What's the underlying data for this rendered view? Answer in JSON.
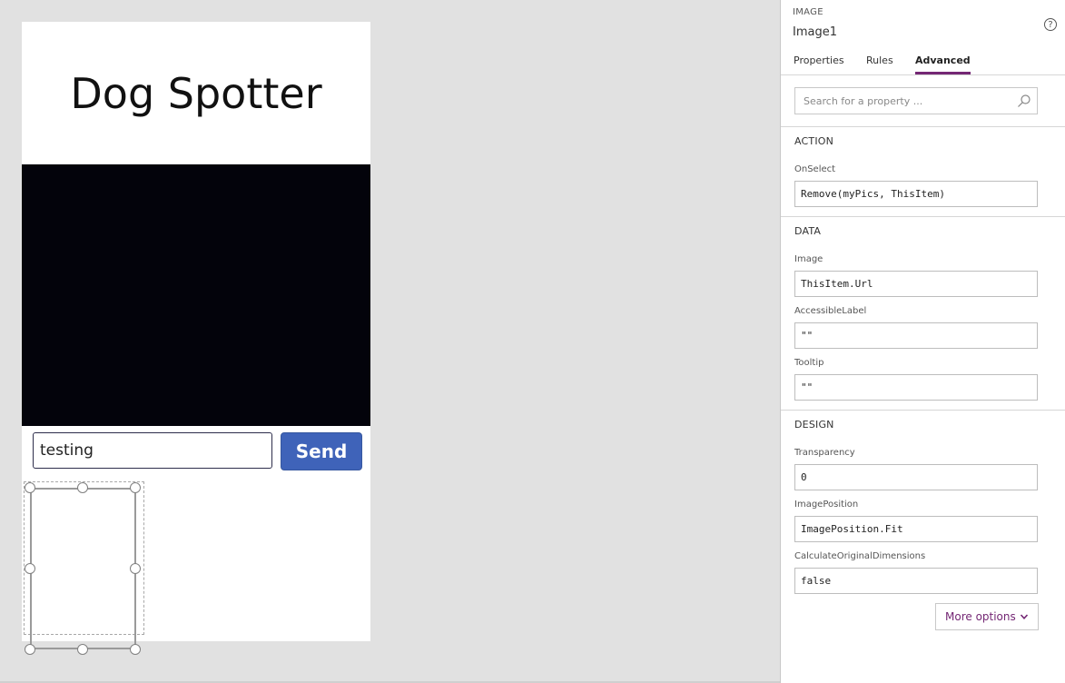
{
  "app": {
    "title": "Dog Spotter",
    "input_value": "testing",
    "send_label": "Send"
  },
  "panel": {
    "control_type": "IMAGE",
    "control_name": "Image1",
    "help_symbol": "?",
    "tabs": [
      "Properties",
      "Rules",
      "Advanced"
    ],
    "active_tab": "Advanced",
    "search_placeholder": "Search for a property ...",
    "sections": {
      "action": {
        "title": "ACTION",
        "onselect_label": "OnSelect",
        "onselect_value": "Remove(myPics, ThisItem)"
      },
      "data": {
        "title": "DATA",
        "image_label": "Image",
        "image_value": "ThisItem.Url",
        "accessible_label": "AccessibleLabel",
        "accessible_value": "\"\"",
        "tooltip_label": "Tooltip",
        "tooltip_value": "\"\""
      },
      "design": {
        "title": "DESIGN",
        "transparency_label": "Transparency",
        "transparency_value": "0",
        "imageposition_label": "ImagePosition",
        "imageposition_value": "ImagePosition.Fit",
        "calcdims_label": "CalculateOriginalDimensions",
        "calcdims_value": "false"
      }
    },
    "more_options_label": "More options"
  },
  "colors": {
    "accent": "#742774",
    "send_button": "#3f63b9",
    "camera_bg": "#03030b"
  }
}
